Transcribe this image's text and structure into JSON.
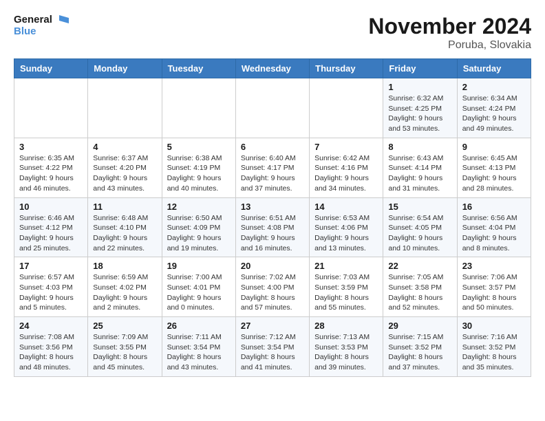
{
  "header": {
    "logo_line1": "General",
    "logo_line2": "Blue",
    "month": "November 2024",
    "location": "Poruba, Slovakia"
  },
  "weekdays": [
    "Sunday",
    "Monday",
    "Tuesday",
    "Wednesday",
    "Thursday",
    "Friday",
    "Saturday"
  ],
  "weeks": [
    [
      {
        "day": "",
        "info": ""
      },
      {
        "day": "",
        "info": ""
      },
      {
        "day": "",
        "info": ""
      },
      {
        "day": "",
        "info": ""
      },
      {
        "day": "",
        "info": ""
      },
      {
        "day": "1",
        "info": "Sunrise: 6:32 AM\nSunset: 4:25 PM\nDaylight: 9 hours\nand 53 minutes."
      },
      {
        "day": "2",
        "info": "Sunrise: 6:34 AM\nSunset: 4:24 PM\nDaylight: 9 hours\nand 49 minutes."
      }
    ],
    [
      {
        "day": "3",
        "info": "Sunrise: 6:35 AM\nSunset: 4:22 PM\nDaylight: 9 hours\nand 46 minutes."
      },
      {
        "day": "4",
        "info": "Sunrise: 6:37 AM\nSunset: 4:20 PM\nDaylight: 9 hours\nand 43 minutes."
      },
      {
        "day": "5",
        "info": "Sunrise: 6:38 AM\nSunset: 4:19 PM\nDaylight: 9 hours\nand 40 minutes."
      },
      {
        "day": "6",
        "info": "Sunrise: 6:40 AM\nSunset: 4:17 PM\nDaylight: 9 hours\nand 37 minutes."
      },
      {
        "day": "7",
        "info": "Sunrise: 6:42 AM\nSunset: 4:16 PM\nDaylight: 9 hours\nand 34 minutes."
      },
      {
        "day": "8",
        "info": "Sunrise: 6:43 AM\nSunset: 4:14 PM\nDaylight: 9 hours\nand 31 minutes."
      },
      {
        "day": "9",
        "info": "Sunrise: 6:45 AM\nSunset: 4:13 PM\nDaylight: 9 hours\nand 28 minutes."
      }
    ],
    [
      {
        "day": "10",
        "info": "Sunrise: 6:46 AM\nSunset: 4:12 PM\nDaylight: 9 hours\nand 25 minutes."
      },
      {
        "day": "11",
        "info": "Sunrise: 6:48 AM\nSunset: 4:10 PM\nDaylight: 9 hours\nand 22 minutes."
      },
      {
        "day": "12",
        "info": "Sunrise: 6:50 AM\nSunset: 4:09 PM\nDaylight: 9 hours\nand 19 minutes."
      },
      {
        "day": "13",
        "info": "Sunrise: 6:51 AM\nSunset: 4:08 PM\nDaylight: 9 hours\nand 16 minutes."
      },
      {
        "day": "14",
        "info": "Sunrise: 6:53 AM\nSunset: 4:06 PM\nDaylight: 9 hours\nand 13 minutes."
      },
      {
        "day": "15",
        "info": "Sunrise: 6:54 AM\nSunset: 4:05 PM\nDaylight: 9 hours\nand 10 minutes."
      },
      {
        "day": "16",
        "info": "Sunrise: 6:56 AM\nSunset: 4:04 PM\nDaylight: 9 hours\nand 8 minutes."
      }
    ],
    [
      {
        "day": "17",
        "info": "Sunrise: 6:57 AM\nSunset: 4:03 PM\nDaylight: 9 hours\nand 5 minutes."
      },
      {
        "day": "18",
        "info": "Sunrise: 6:59 AM\nSunset: 4:02 PM\nDaylight: 9 hours\nand 2 minutes."
      },
      {
        "day": "19",
        "info": "Sunrise: 7:00 AM\nSunset: 4:01 PM\nDaylight: 9 hours\nand 0 minutes."
      },
      {
        "day": "20",
        "info": "Sunrise: 7:02 AM\nSunset: 4:00 PM\nDaylight: 8 hours\nand 57 minutes."
      },
      {
        "day": "21",
        "info": "Sunrise: 7:03 AM\nSunset: 3:59 PM\nDaylight: 8 hours\nand 55 minutes."
      },
      {
        "day": "22",
        "info": "Sunrise: 7:05 AM\nSunset: 3:58 PM\nDaylight: 8 hours\nand 52 minutes."
      },
      {
        "day": "23",
        "info": "Sunrise: 7:06 AM\nSunset: 3:57 PM\nDaylight: 8 hours\nand 50 minutes."
      }
    ],
    [
      {
        "day": "24",
        "info": "Sunrise: 7:08 AM\nSunset: 3:56 PM\nDaylight: 8 hours\nand 48 minutes."
      },
      {
        "day": "25",
        "info": "Sunrise: 7:09 AM\nSunset: 3:55 PM\nDaylight: 8 hours\nand 45 minutes."
      },
      {
        "day": "26",
        "info": "Sunrise: 7:11 AM\nSunset: 3:54 PM\nDaylight: 8 hours\nand 43 minutes."
      },
      {
        "day": "27",
        "info": "Sunrise: 7:12 AM\nSunset: 3:54 PM\nDaylight: 8 hours\nand 41 minutes."
      },
      {
        "day": "28",
        "info": "Sunrise: 7:13 AM\nSunset: 3:53 PM\nDaylight: 8 hours\nand 39 minutes."
      },
      {
        "day": "29",
        "info": "Sunrise: 7:15 AM\nSunset: 3:52 PM\nDaylight: 8 hours\nand 37 minutes."
      },
      {
        "day": "30",
        "info": "Sunrise: 7:16 AM\nSunset: 3:52 PM\nDaylight: 8 hours\nand 35 minutes."
      }
    ]
  ]
}
